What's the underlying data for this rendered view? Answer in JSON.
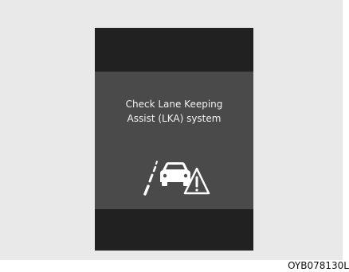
{
  "display": {
    "message_line1": "Check Lane Keeping",
    "message_line2": "Assist (LKA) system",
    "icon": "lka-warning-icon"
  },
  "caption": {
    "code": "OYB078130L"
  },
  "colors": {
    "panel": "#4a4a4a",
    "band": "#212121",
    "text": "#f2f2f2",
    "frame": "#e9e9e9"
  }
}
